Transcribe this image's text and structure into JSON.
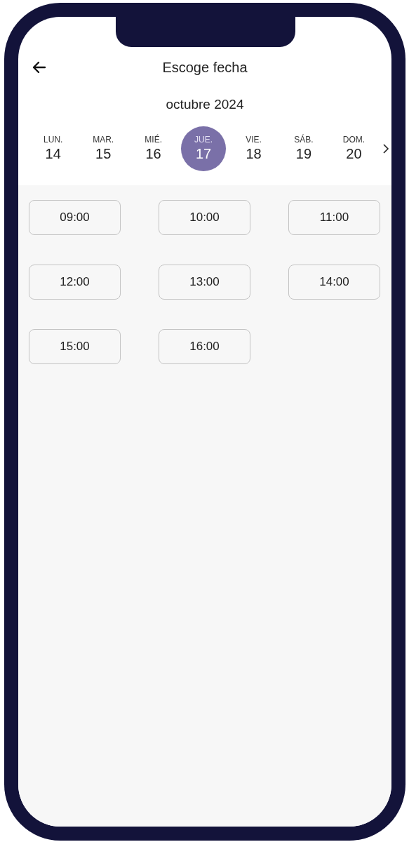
{
  "header": {
    "title": "Escoge fecha"
  },
  "calendar": {
    "month": "octubre 2024",
    "days": [
      {
        "weekday": "LUN.",
        "day": "14",
        "selected": false
      },
      {
        "weekday": "MAR.",
        "day": "15",
        "selected": false
      },
      {
        "weekday": "MIÉ.",
        "day": "16",
        "selected": false
      },
      {
        "weekday": "JUE.",
        "day": "17",
        "selected": true
      },
      {
        "weekday": "VIE.",
        "day": "18",
        "selected": false
      },
      {
        "weekday": "SÁB.",
        "day": "19",
        "selected": false
      },
      {
        "weekday": "DOM.",
        "day": "20",
        "selected": false
      }
    ]
  },
  "time_slots": [
    "09:00",
    "10:00",
    "11:00",
    "12:00",
    "13:00",
    "14:00",
    "15:00",
    "16:00"
  ]
}
